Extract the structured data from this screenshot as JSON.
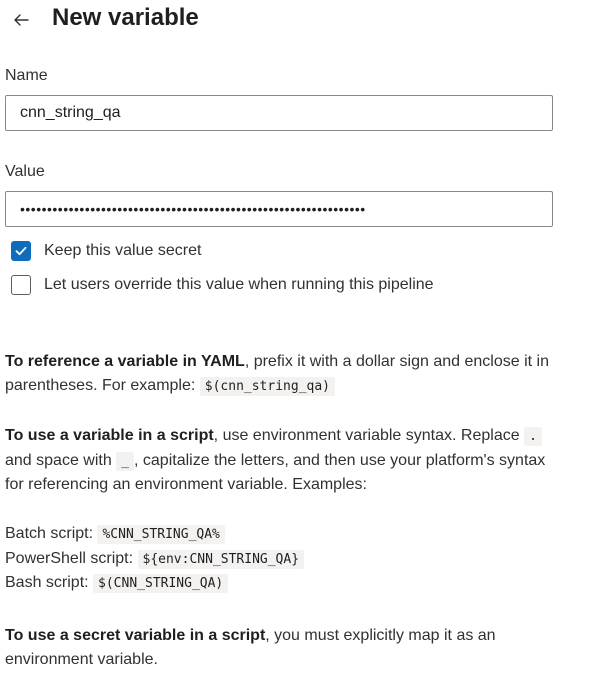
{
  "header": {
    "back_icon": "arrow-left-icon",
    "title": "New variable"
  },
  "name_field": {
    "label": "Name",
    "value": "cnn_string_qa"
  },
  "value_field": {
    "label": "Value",
    "masked_value": "••••••••••••••••••••••••••••••••••••••••••••••••••••••••••••••••"
  },
  "options": {
    "keep_secret": {
      "label": "Keep this value secret",
      "checked": true
    },
    "allow_override": {
      "label": "Let users override this value when running this pipeline",
      "checked": false
    }
  },
  "help": {
    "yaml": {
      "bold": "To reference a variable in YAML",
      "text1": ", prefix it with a dollar sign and enclose it in parentheses. For example: ",
      "code": "$(cnn_string_qa)"
    },
    "script": {
      "bold": "To use a variable in a script",
      "text1": ", use environment variable syntax. Replace ",
      "code_dot": ".",
      "text2": " and space with ",
      "code_underscore": "_",
      "text3": ", capitalize the letters, and then use your platform's syntax for referencing an environment variable. Examples:"
    },
    "examples": {
      "batch_label": "Batch script: ",
      "batch_code": "%CNN_STRING_QA%",
      "powershell_label": "PowerShell script: ",
      "powershell_code": "${env:CNN_STRING_QA}",
      "bash_label": "Bash script: ",
      "bash_code": "$(CNN_STRING_QA)"
    },
    "secret": {
      "bold": "To use a secret variable in a script",
      "text1": ", you must explicitly map it as an environment variable."
    }
  },
  "colors": {
    "accent": "#0f6cbd",
    "code_bg": "#f3f2f1"
  }
}
